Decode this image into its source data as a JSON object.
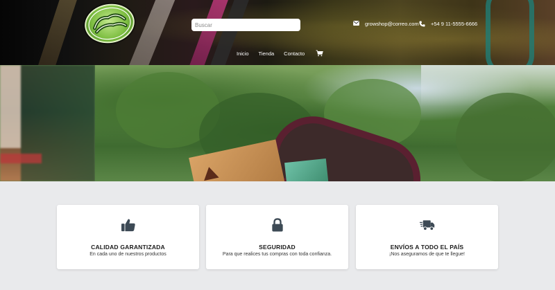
{
  "header": {
    "search_placeholder": "Buscar",
    "email": "growshop@correo.com",
    "phone": "+54 9 11-5555-6666",
    "nav": [
      "Inicio",
      "Tienda",
      "Contacto"
    ],
    "logo_icon": "jungle-grow-shop-logo"
  },
  "features": [
    {
      "icon": "thumbs-up-icon",
      "title": "CALIDAD GARANTIZADA",
      "desc": "En cada uno de nuestros productos"
    },
    {
      "icon": "lock-icon",
      "title": "SEGURIDAD",
      "desc": "Para que realices tus compras con toda confianza."
    },
    {
      "icon": "truck-icon",
      "title": "ENVÍOS A TODO EL PAÍS",
      "desc": "¡Nos aseguramos de que te llegue!"
    }
  ],
  "colors": {
    "page_bg": "#e9eaec",
    "card_bg": "#ffffff",
    "icon_color": "#3d4a55",
    "header_text": "#ffffff"
  }
}
